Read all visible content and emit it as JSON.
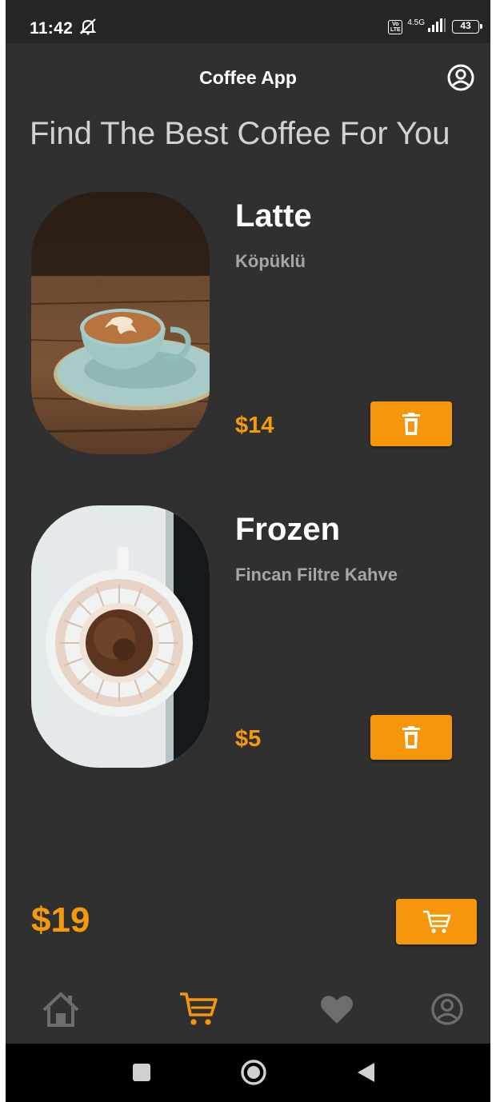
{
  "status_bar": {
    "time": "11:42",
    "volte_label": "Vo LTE",
    "network_label": "4.5G",
    "battery": "43"
  },
  "app_bar": {
    "title": "Coffee App",
    "profile_icon": "account-circle-icon"
  },
  "headline": "Find The Best Coffee For You",
  "cart_items": [
    {
      "name": "Latte",
      "description": "Köpüklü",
      "price": "$14",
      "image": "latte-cup-photo",
      "delete_icon": "trash-icon"
    },
    {
      "name": "Frozen",
      "description": "Fincan Filtre Kahve",
      "price": "$5",
      "image": "filter-coffee-photo",
      "delete_icon": "trash-icon"
    }
  ],
  "total": "$19",
  "checkout_icon": "cart-icon",
  "bottom_nav": [
    {
      "id": "home",
      "icon": "home-icon",
      "active": false
    },
    {
      "id": "cart",
      "icon": "cart-icon",
      "active": true
    },
    {
      "id": "favorites",
      "icon": "heart-icon",
      "active": false
    },
    {
      "id": "profile",
      "icon": "account-circle-icon",
      "active": false
    }
  ],
  "colors": {
    "background": "#303030",
    "accent": "#f6970b",
    "inactive_icon": "#6d6d6d",
    "text_secondary": "#a6a6a6"
  }
}
